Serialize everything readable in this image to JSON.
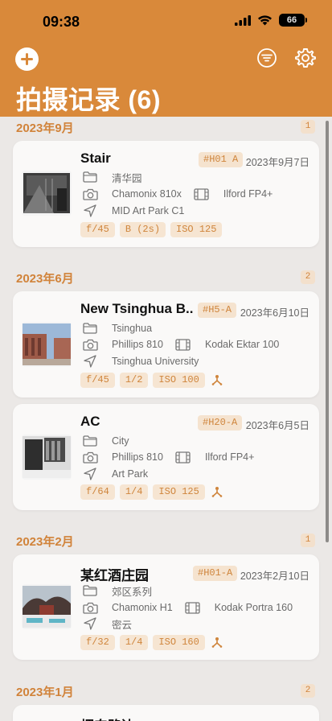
{
  "status": {
    "time": "09:38",
    "battery": "66"
  },
  "header": {
    "title": "拍摄记录 (6)"
  },
  "sections": [
    {
      "title": "2023年9月",
      "count": "1"
    },
    {
      "title": "2023年6月",
      "count": "2"
    },
    {
      "title": "2023年2月",
      "count": "1"
    },
    {
      "title": "2023年1月",
      "count": "2"
    }
  ],
  "records": [
    {
      "title": "Stair",
      "code": "#H01 A",
      "date": "2023年9月7日",
      "folder": "清华园",
      "camera": "Chamonix 810x",
      "film": "Ilford FP4+",
      "location": "MID Art Park C1",
      "aperture": "f/45",
      "shutter": "B (2s)",
      "iso": "ISO 125",
      "has_extra": false
    },
    {
      "title": "New Tsinghua B...",
      "code": "#H5-A",
      "date": "2023年6月10日",
      "folder": "Tsinghua",
      "camera": "Phillips 810",
      "film": "Kodak Ektar 100",
      "location": "Tsinghua University",
      "aperture": "f/45",
      "shutter": "1/2",
      "iso": "ISO 100",
      "has_extra": true
    },
    {
      "title": "AC",
      "code": "#H20-A",
      "date": "2023年6月5日",
      "folder": "City",
      "camera": "Phillips 810",
      "film": "Ilford FP4+",
      "location": "Art Park",
      "aperture": "f/64",
      "shutter": "1/4",
      "iso": "ISO 125",
      "has_extra": true
    },
    {
      "title": "某红酒庄园",
      "code": "#H01-A",
      "date": "2023年2月10日",
      "folder": "郊区系列",
      "camera": "Chamonix H1",
      "film": "Kodak Portra 160",
      "location": "密云",
      "aperture": "f/32",
      "shutter": "1/4",
      "iso": "ISO 160",
      "has_extra": true
    },
    {
      "title": "烟囱路边",
      "code": "",
      "date": "",
      "folder": "",
      "camera": "",
      "film": "",
      "location": "",
      "aperture": "",
      "shutter": "",
      "iso": "",
      "has_extra": false
    }
  ],
  "colors": {
    "accent": "#d9893a",
    "chip_bg": "#f6e5d2",
    "chip_text": "#cf853c",
    "background": "#ebe8e6"
  },
  "icons": [
    "plus-icon",
    "filter-icon",
    "gear-icon",
    "folder-icon",
    "camera-icon",
    "film-icon",
    "location-arrow-icon",
    "tripod-icon"
  ]
}
